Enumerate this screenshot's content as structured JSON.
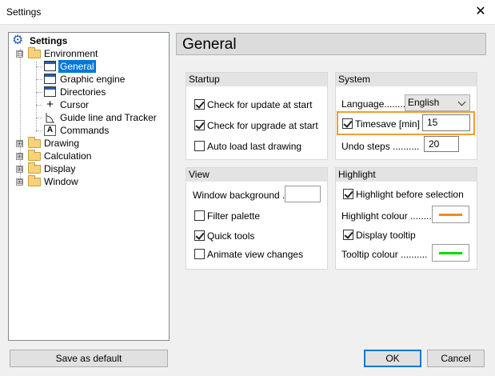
{
  "window": {
    "title": "Settings",
    "close_glyph": "✕"
  },
  "tree": {
    "root": "Settings",
    "items": [
      {
        "label": "Environment",
        "icon": "folder-open-icon",
        "expander": "⊟"
      },
      {
        "label": "General",
        "icon": "window-icon",
        "selected": true
      },
      {
        "label": "Graphic engine",
        "icon": "window-icon"
      },
      {
        "label": "Directories",
        "icon": "folder-window-icon"
      },
      {
        "label": "Cursor",
        "icon": "crosshair-icon",
        "glyph": "+"
      },
      {
        "label": "Guide line and Tracker",
        "icon": "guide-line-icon"
      },
      {
        "label": "Commands",
        "icon": "text-command-icon",
        "glyph": "A"
      },
      {
        "label": "Drawing",
        "icon": "folder-icon",
        "expander": "⊞"
      },
      {
        "label": "Calculation",
        "icon": "folder-icon",
        "expander": "⊞"
      },
      {
        "label": "Display",
        "icon": "folder-icon",
        "expander": "⊞"
      },
      {
        "label": "Window",
        "icon": "folder-icon",
        "expander": "⊞"
      }
    ]
  },
  "header": {
    "title": "General"
  },
  "startup": {
    "title": "Startup",
    "options": [
      {
        "label": "Check for update at start",
        "checked": true
      },
      {
        "label": "Check for upgrade at start",
        "checked": true
      },
      {
        "label": "Auto load last drawing",
        "checked": false
      }
    ]
  },
  "system": {
    "title": "System",
    "language_label": "Language........",
    "language_value": "English",
    "timesave_label": "Timesave [min] ..",
    "timesave_checked": true,
    "timesave_value": "15",
    "undo_label": "Undo steps ..........",
    "undo_value": "20"
  },
  "view": {
    "title": "View",
    "window_background_label": "Window background ...",
    "options": [
      {
        "label": "Filter palette",
        "checked": false
      },
      {
        "label": "Quick tools",
        "checked": true
      },
      {
        "label": "Animate view changes",
        "checked": false
      }
    ]
  },
  "highlight": {
    "title": "Highlight",
    "before_selection_label": "Highlight before selection",
    "before_selection_checked": true,
    "colour_label": "Highlight colour ..........",
    "colour_value": "#f08c1e",
    "tooltip_label": "Display tooltip",
    "tooltip_checked": true,
    "tooltip_colour_label": "Tooltip colour ..........",
    "tooltip_colour_value": "#00dc00"
  },
  "buttons": {
    "save_default": "Save as default",
    "ok": "OK",
    "cancel": "Cancel"
  },
  "colors": {
    "accent": "#0078d7",
    "highlight_frame": "#f39c33"
  }
}
